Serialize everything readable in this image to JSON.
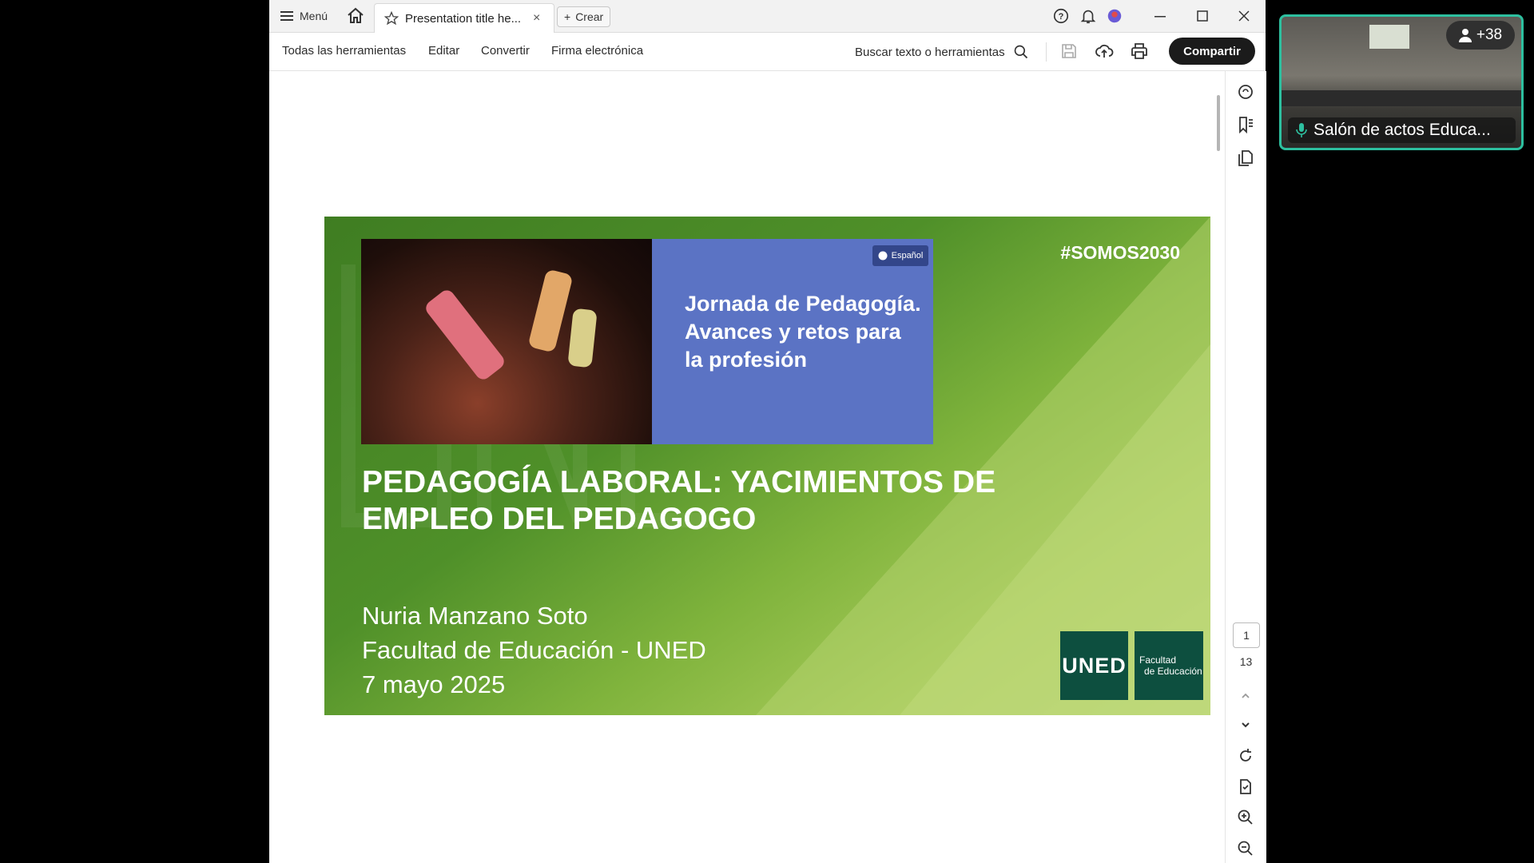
{
  "titlebar": {
    "menu_label": "Menú",
    "tab_title": "Presentation title he...",
    "tab_close": "×",
    "create_label": "Crear"
  },
  "toolbar": {
    "all_tools": "Todas las herramientas",
    "edit": "Editar",
    "convert": "Convertir",
    "esign": "Firma electrónica",
    "search_label": "Buscar texto o herramientas",
    "share_label": "Compartir"
  },
  "navigation": {
    "current_page": "1",
    "total_pages": "13"
  },
  "slide": {
    "language_badge": "Español",
    "event_title": "Jornada de Pedagogía. Avances y retos para la profesión",
    "hashtag": "#SOMOS2030",
    "title_line1": "PEDAGOGÍA LABORAL: YACIMIENTOS DE",
    "title_line2": "EMPLEO DEL PEDAGOGO",
    "author": "Nuria Manzano Soto",
    "faculty": "Facultad de Educación - UNED",
    "date": "7 mayo 2025",
    "logo_uned": "UNED",
    "logo_faculty_line1": "Facultad",
    "logo_faculty_line2": "de Educación"
  },
  "video_call": {
    "participant_count": "+38",
    "room_label": "Salón de actos Educa..."
  },
  "colors": {
    "share_button": "#1b1b1b",
    "uned_green": "#0d4f3f",
    "slide_blue": "#5b73c4",
    "video_border": "#2dbf9f"
  }
}
